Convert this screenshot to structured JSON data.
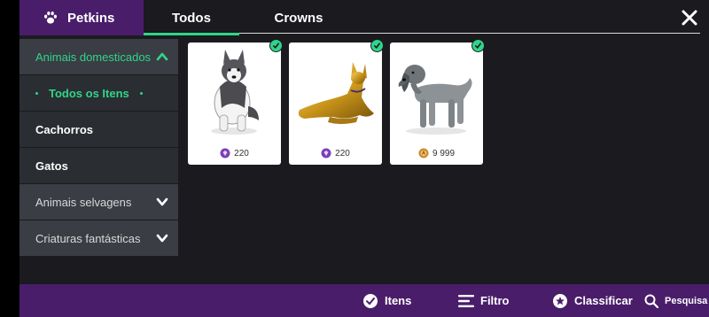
{
  "header": {
    "brand": "Petkins",
    "tabs": [
      {
        "label": "Todos",
        "active": true
      },
      {
        "label": "Crowns",
        "active": false
      }
    ],
    "close_icon": "close-icon"
  },
  "sidebar": {
    "categories": [
      {
        "label": "Animais domesticados",
        "expanded": true
      },
      {
        "label": "Animais selvagens",
        "expanded": false
      },
      {
        "label": "Criaturas fantásticas",
        "expanded": false
      }
    ],
    "subitems": [
      {
        "label": "Todos os Itens",
        "selected": true
      },
      {
        "label": "Cachorros",
        "selected": false
      },
      {
        "label": "Gatos",
        "selected": false
      }
    ]
  },
  "items": [
    {
      "name": "husky-puppy",
      "price": "220",
      "currency": "gem-icon",
      "owned": true
    },
    {
      "name": "golden-cat",
      "price": "220",
      "currency": "gem-icon",
      "owned": true
    },
    {
      "name": "setter-dog",
      "price": "9 999",
      "currency": "coin-icon",
      "owned": true
    }
  ],
  "toolbar": {
    "itens": "Itens",
    "filtro": "Filtro",
    "classificar": "Classificar",
    "pesquisa": "Pesquisa"
  },
  "colors": {
    "accent": "#2fd58a",
    "brand": "#4a1d6a",
    "background": "#1b1a1f",
    "sidebar_category": "#3a3d44",
    "sidebar_sub": "#2a2d31",
    "gem": "#7b3fb8",
    "coin": "#c88a2e"
  }
}
